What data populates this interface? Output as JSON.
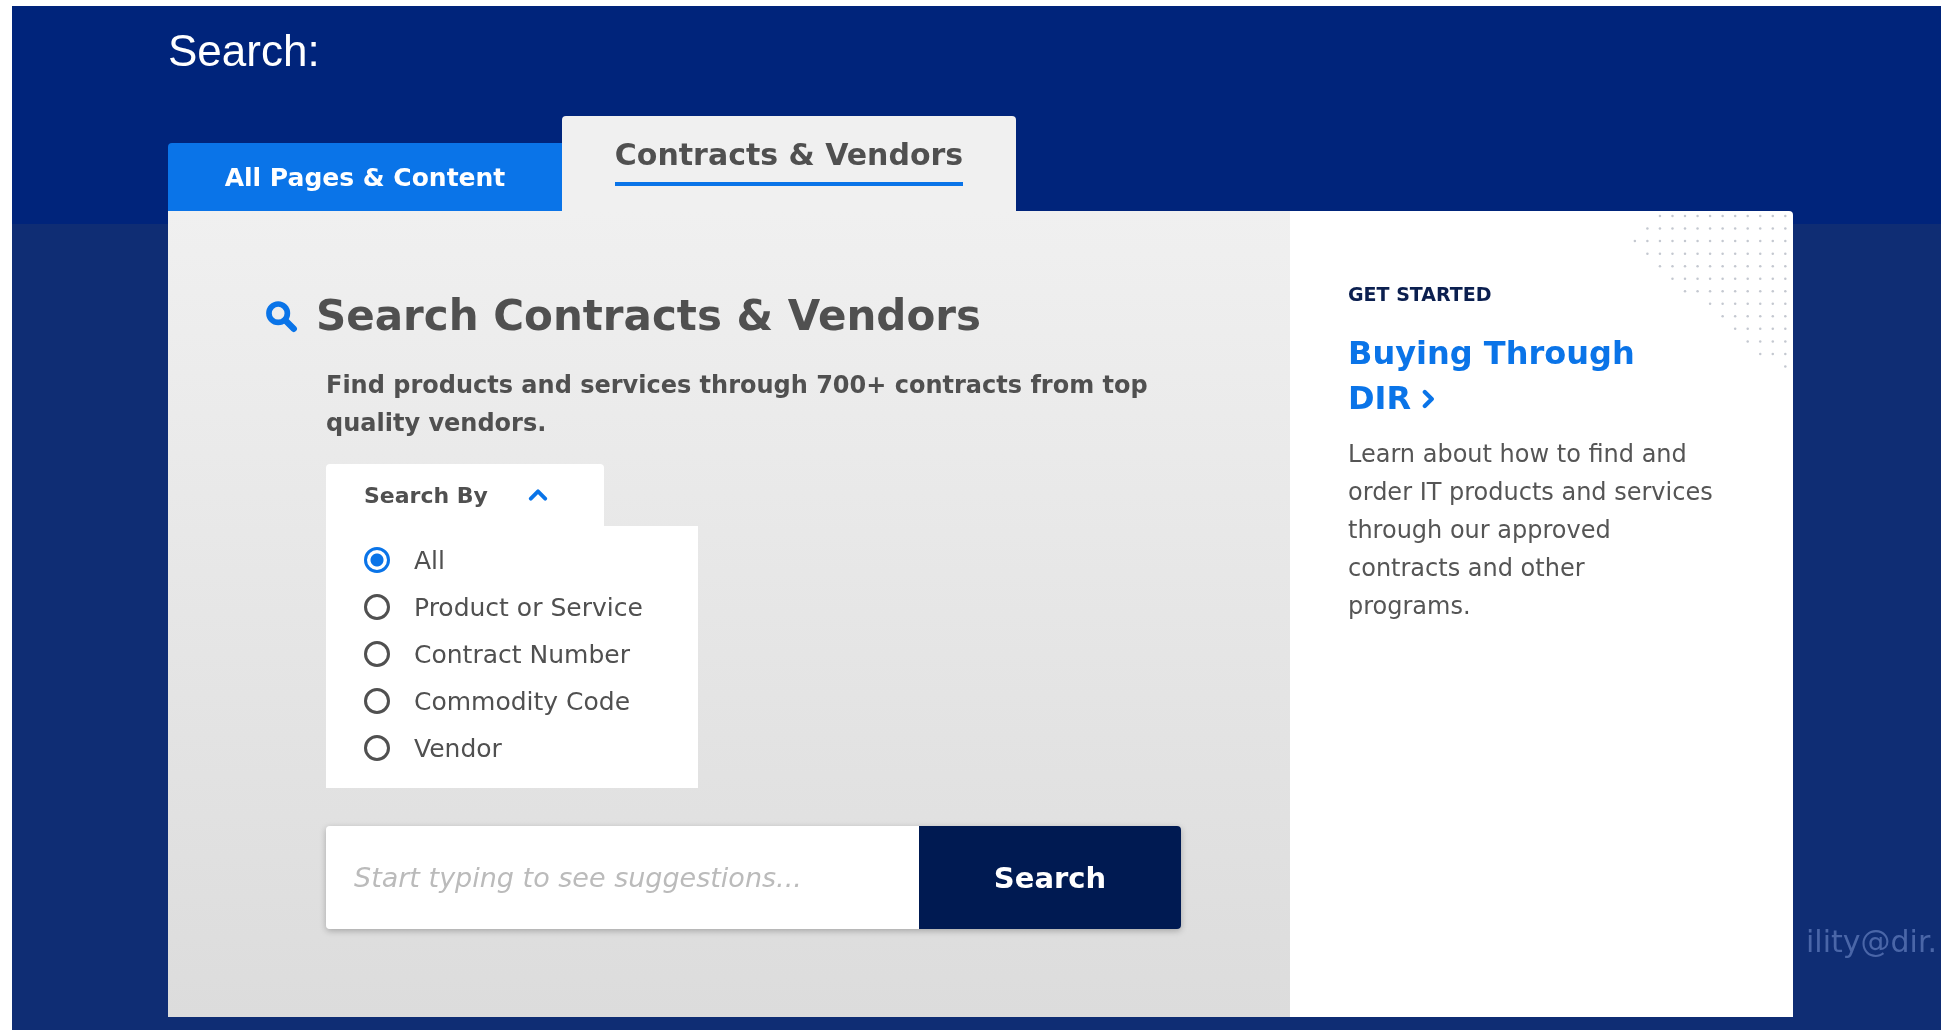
{
  "header": {
    "title": "Search:"
  },
  "tabs": [
    {
      "label": "All Pages & Content",
      "selected": false
    },
    {
      "label": "Contracts & Vendors",
      "selected": true
    }
  ],
  "search_panel": {
    "heading": "Search Contracts & Vendors",
    "description": "Find products and services through 700+ contracts from top quality vendors.",
    "search_by": {
      "label": "Search By",
      "expanded": true,
      "options": [
        {
          "label": "All",
          "selected": true
        },
        {
          "label": "Product or Service",
          "selected": false
        },
        {
          "label": "Contract Number",
          "selected": false
        },
        {
          "label": "Commodity Code",
          "selected": false
        },
        {
          "label": "Vendor",
          "selected": false
        }
      ]
    },
    "search_field": {
      "placeholder": "Start typing to see suggestions..."
    },
    "search_button": "Search"
  },
  "sidebar": {
    "eyebrow": "GET STARTED",
    "link": "Buying Through DIR",
    "body": "Learn about how to find and order IT products and services through our approved contracts and other programs."
  },
  "background_text": "ility@dir."
}
